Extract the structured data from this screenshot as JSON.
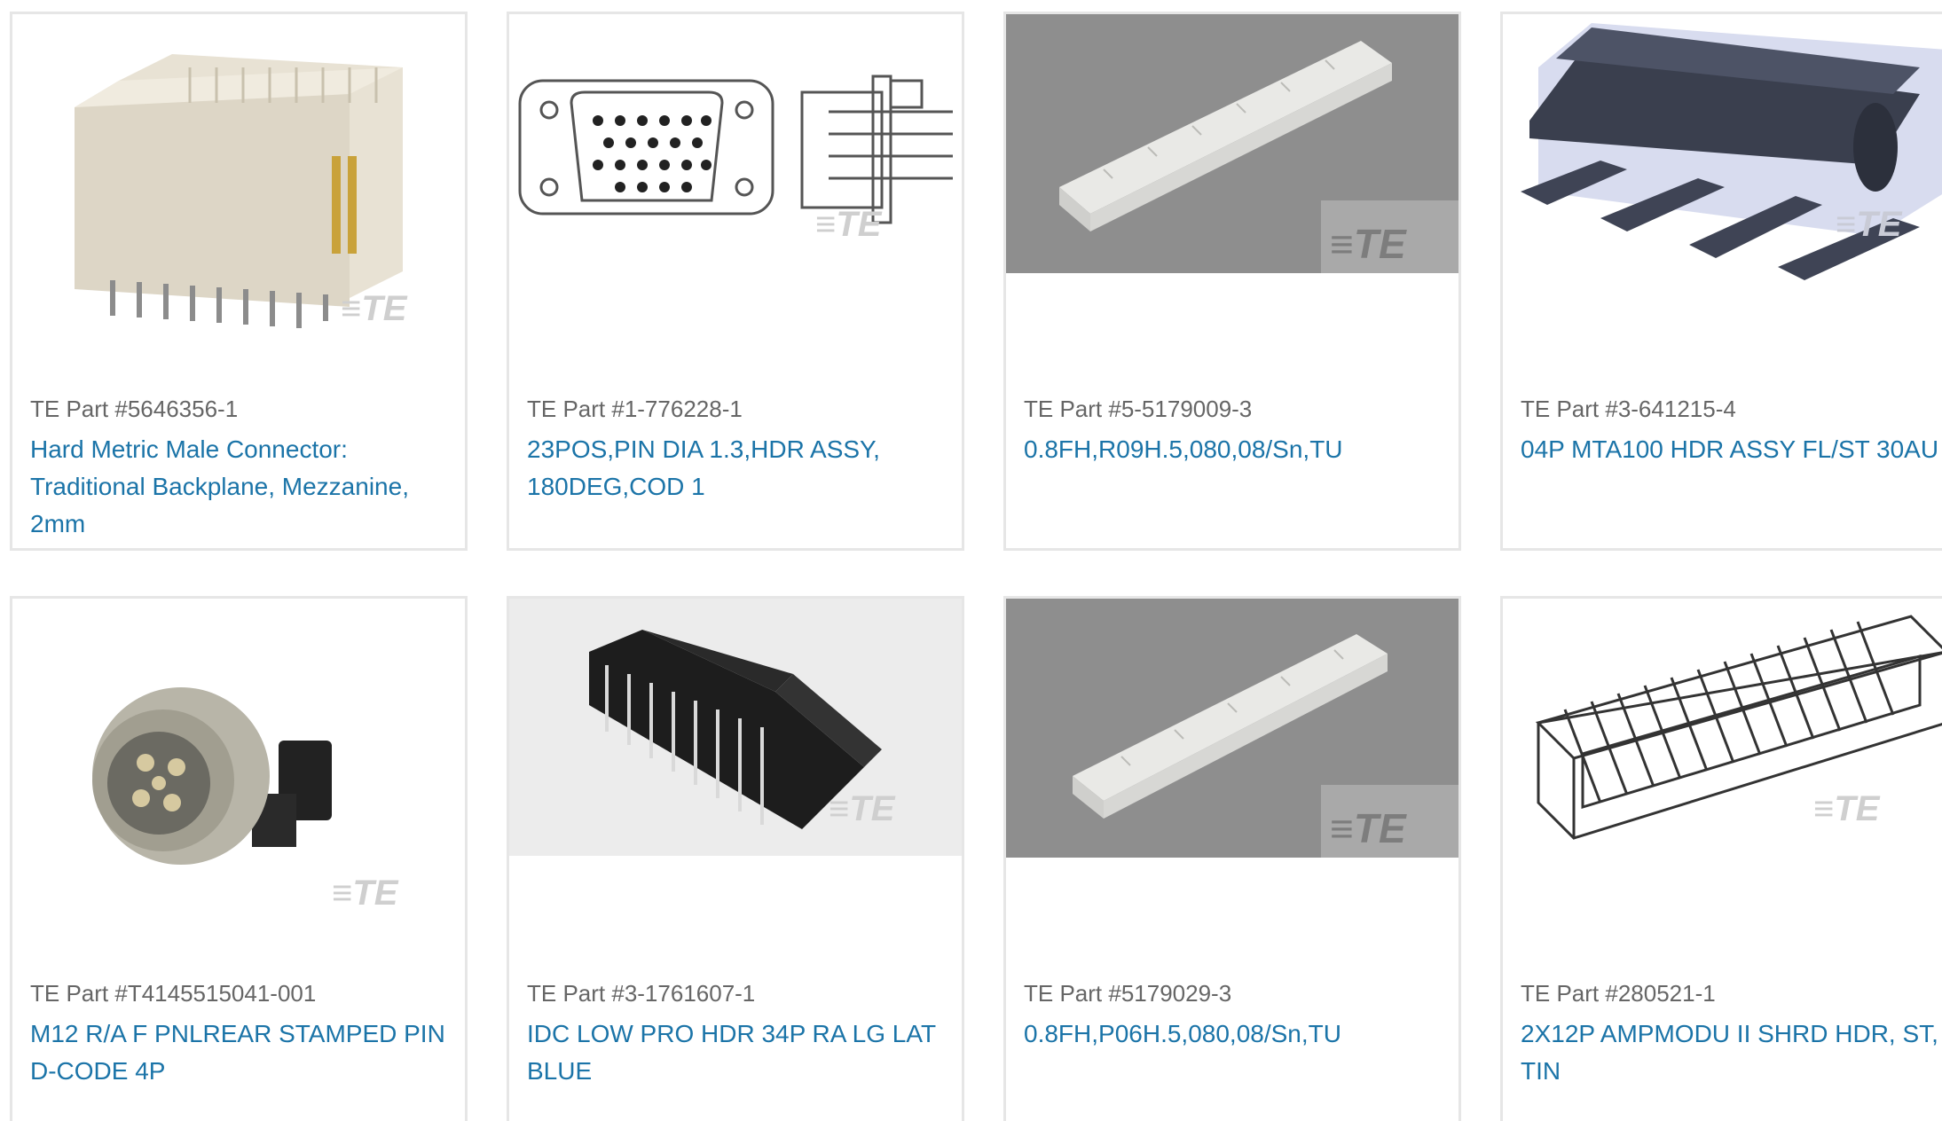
{
  "brand": {
    "watermark": "TE",
    "link_color": "#1b74a8",
    "part_color": "#666666"
  },
  "products": [
    {
      "part_label": "TE Part #5646356-1",
      "description": "Hard Metric Male Connector: Traditional Backplane, Mezzanine, 2mm",
      "image": "beige-backplane-connector-image"
    },
    {
      "part_label": "TE Part #1-776228-1",
      "description": "23POS,PIN DIA 1.3,HDR ASSY, 180DEG,COD 1",
      "image": "line-drawing-header-image"
    },
    {
      "part_label": "TE Part #5-5179009-3",
      "description": "0.8FH,R09H.5,080,08/Sn,TU",
      "image": "white-board-connector-on-gray-image"
    },
    {
      "part_label": "TE Part #3-641215-4",
      "description": "04P MTA100 HDR ASSY FL/ST 30AU",
      "image": "dark-header-pins-image"
    },
    {
      "part_label": "TE Part #T4145515041-001",
      "description": "M12 R/A F PNLREAR STAMPED PIN D-CODE 4P",
      "image": "round-m12-connector-image"
    },
    {
      "part_label": "TE Part #3-1761607-1",
      "description": "IDC LOW PRO HDR 34P RA LG LAT BLUE",
      "image": "black-idc-header-image"
    },
    {
      "part_label": "TE Part #5179029-3",
      "description": "0.8FH,P06H.5,080,08/Sn,TU",
      "image": "white-board-connector-on-gray-image"
    },
    {
      "part_label": "TE Part #280521-1",
      "description": "2X12P AMPMODU II SHRD HDR, ST, TIN",
      "image": "shrouded-header-drawing-image"
    }
  ]
}
